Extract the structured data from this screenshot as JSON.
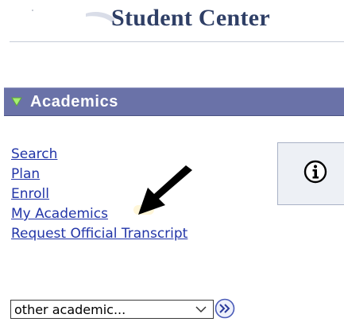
{
  "header": {
    "title": "Student Center"
  },
  "section": {
    "title": "Academics"
  },
  "links": [
    {
      "label": "Search"
    },
    {
      "label": "Plan"
    },
    {
      "label": "Enroll"
    },
    {
      "label": "My Academics"
    },
    {
      "label": "Request Official Transcript"
    }
  ],
  "info_box": {
    "icon": "info-icon"
  },
  "dropdown": {
    "value": "other academic..."
  },
  "colors": {
    "section_header_bg": "#6a72a8",
    "link": "#2235a8",
    "title": "#2f3f66",
    "toggle": "#9de86b"
  },
  "icons": {
    "toggle": "triangle-down-icon",
    "arrow": "arrow-pointer-icon",
    "go": "double-chevron-right-icon"
  }
}
